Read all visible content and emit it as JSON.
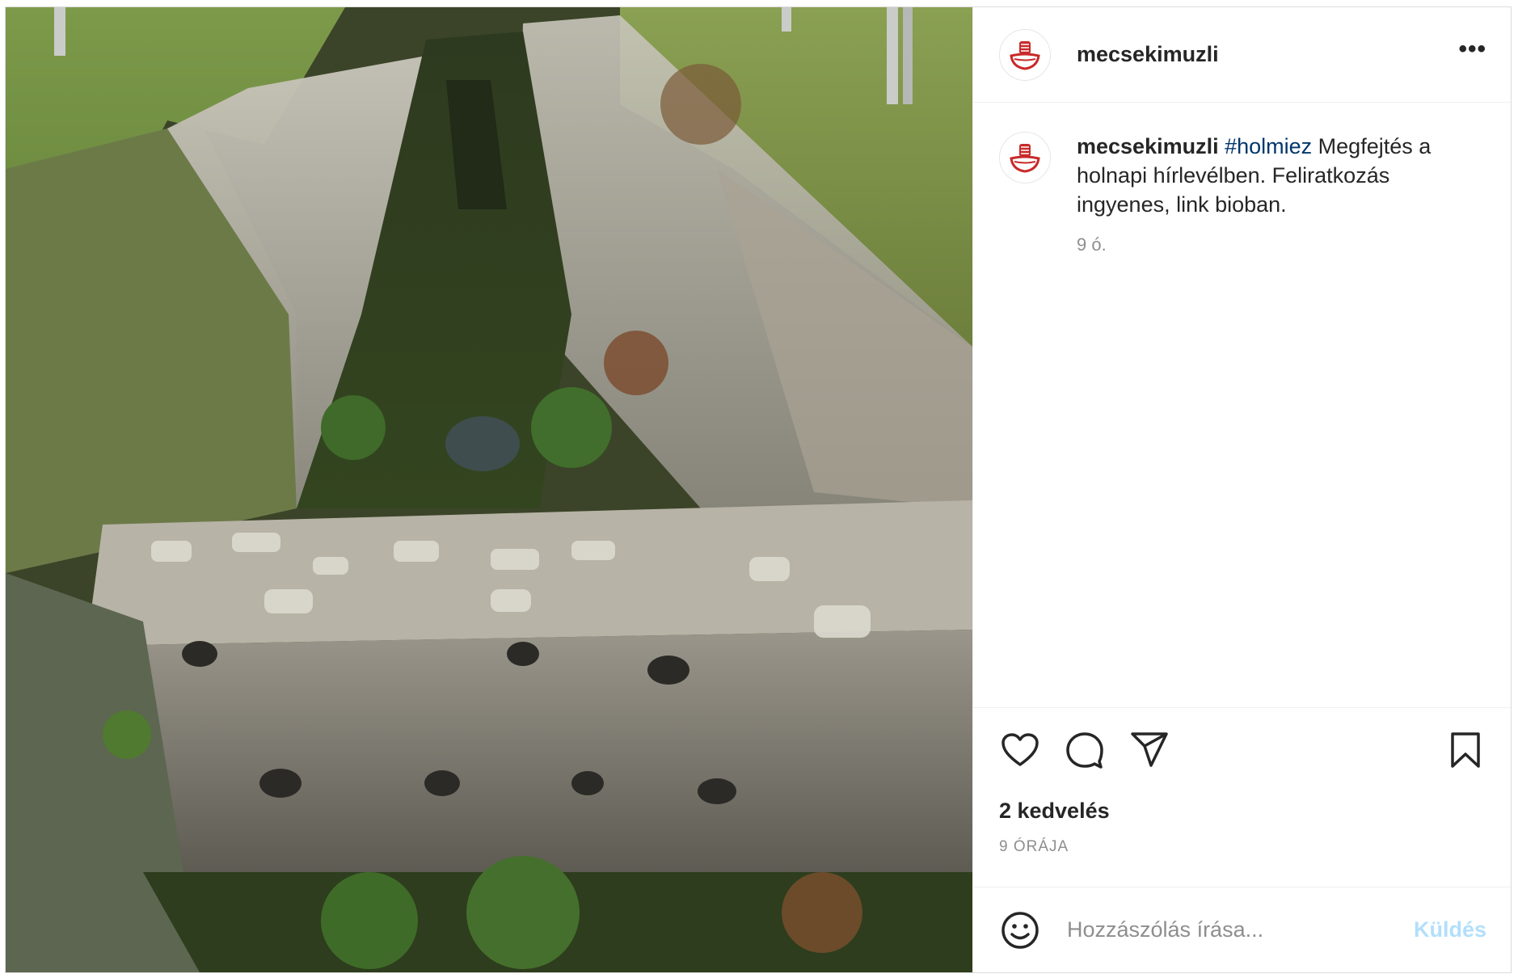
{
  "post": {
    "username": "mecsekimuzli",
    "more_label": "•••",
    "caption": {
      "username": "mecsekimuzli",
      "hashtag": "#holmiez",
      "text": " Megfejtés a holnapi hírlevélben. Feliratkozás ingyenes, link bioban.",
      "time": "9 ó."
    },
    "likes": "2 kedvelés",
    "posted_ago": "9 ÓRÁJA",
    "comment": {
      "placeholder": "Hozzászólás írása...",
      "send_label": "Küldés"
    },
    "icons": {
      "avatar": "logo-icon",
      "like": "heart-icon",
      "comment": "comment-icon",
      "share": "paper-plane-icon",
      "save": "bookmark-icon",
      "emoji": "smiley-icon"
    }
  },
  "colors": {
    "accent": "#c92a2a",
    "hashtag": "#00376b",
    "muted": "#8e8e8e",
    "send_disabled": "#b2dffc"
  }
}
